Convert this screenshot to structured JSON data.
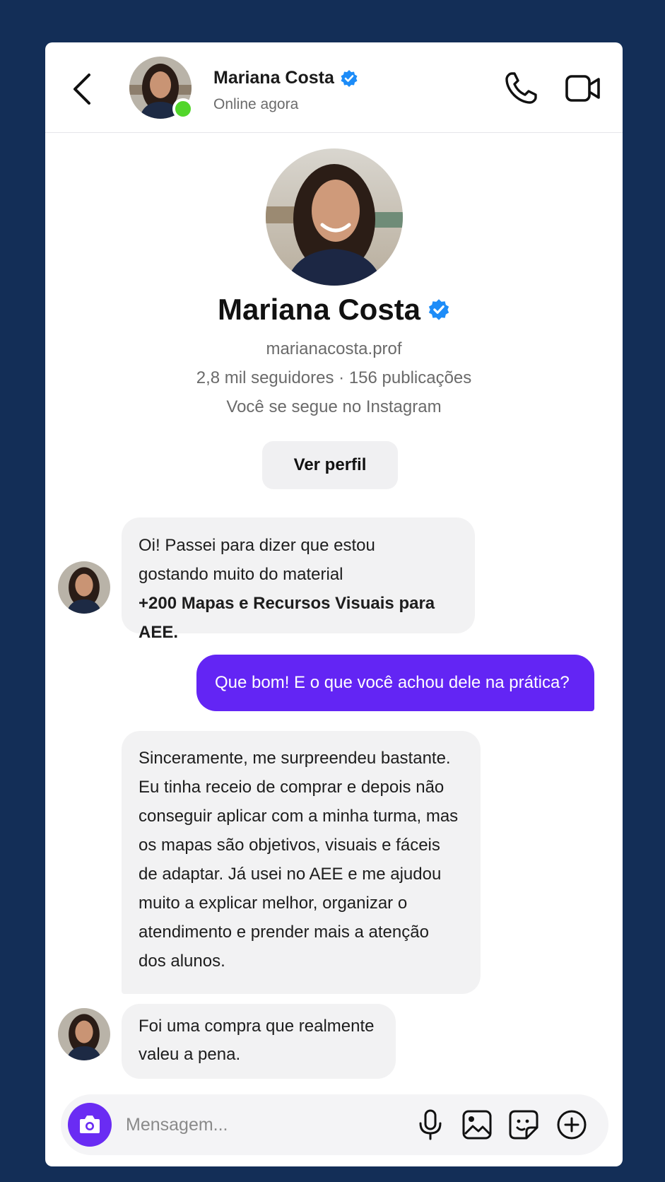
{
  "header": {
    "name": "Mariana Costa",
    "status": "Online agora"
  },
  "profile": {
    "name": "Mariana Costa",
    "handle": "marianacosta.prof",
    "stats": "2,8 mil seguidores · 156 publicações",
    "follow_note": "Você se segue no Instagram",
    "view_profile_label": "Ver perfil"
  },
  "messages": [
    {
      "from": "them",
      "lines": [
        "Oi! Passei para dizer que estou",
        "gostando muito do material"
      ],
      "bold_line": "+200 Mapas e Recursos Visuais para AEE."
    },
    {
      "from": "me",
      "text": "Que bom! E o que você achou dele na prática?"
    },
    {
      "from": "them",
      "lines": [
        "Sinceramente, me surpreendeu bastante.",
        "Eu tinha receio de comprar e depois não",
        "conseguir aplicar com a minha turma, mas",
        "os mapas são objetivos, visuais e fáceis",
        "de adaptar. Já usei no AEE e me ajudou",
        "muito a explicar melhor, organizar o",
        "atendimento e prender mais a atenção",
        "dos alunos."
      ]
    },
    {
      "from": "them",
      "lines": [
        "Foi uma compra que realmente",
        "valeu a pena."
      ]
    }
  ],
  "composer": {
    "placeholder": "Mensagem...",
    "icons": [
      "camera-icon",
      "microphone-icon",
      "image-icon",
      "sticker-icon",
      "plus-icon"
    ]
  },
  "colors": {
    "background": "#132e57",
    "accent": "#6325f4",
    "verified": "#1d8cf8",
    "online": "#52d62a"
  }
}
